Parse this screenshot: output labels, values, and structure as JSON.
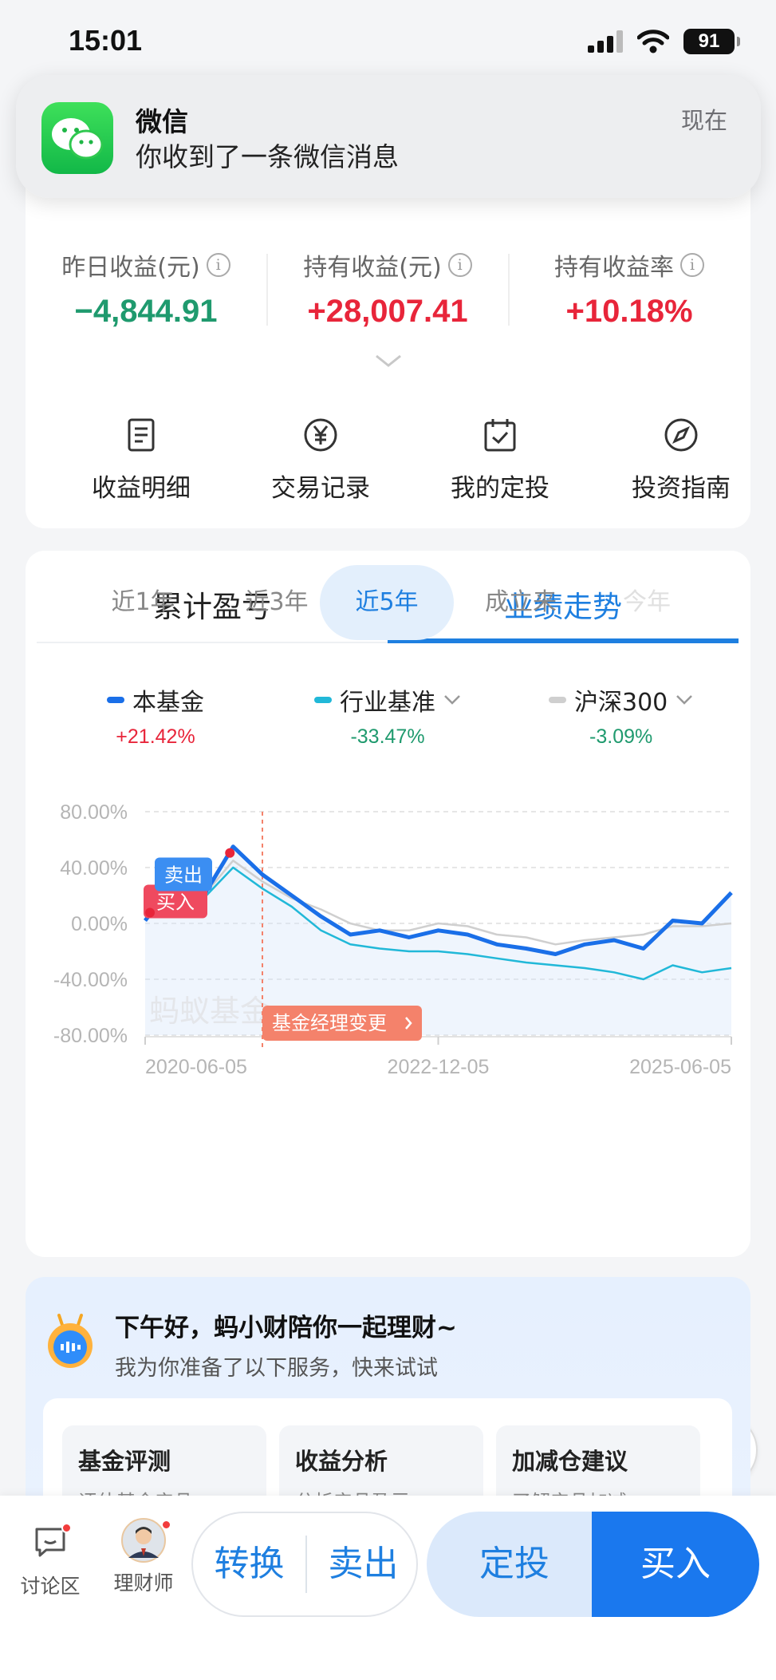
{
  "status_bar": {
    "time": "15:01",
    "battery": "91"
  },
  "notification": {
    "app": "微信",
    "message": "你收到了一条微信消息",
    "time": "现在"
  },
  "profit": {
    "stats": [
      {
        "label": "昨日收益(元)",
        "value": "−4,844.91",
        "color": "#1f9a6e"
      },
      {
        "label": "持有收益(元)",
        "value": "+28,007.41",
        "color": "#e8253a"
      },
      {
        "label": "持有收益率",
        "value": "+10.18%",
        "color": "#e8253a"
      }
    ],
    "actions": [
      {
        "label": "收益明细",
        "icon": "document-icon"
      },
      {
        "label": "交易记录",
        "icon": "yen-circle-icon"
      },
      {
        "label": "我的定投",
        "icon": "calendar-check-icon"
      },
      {
        "label": "投资指南",
        "icon": "compass-icon"
      }
    ]
  },
  "tabs": [
    {
      "label": "累计盈亏",
      "active": false
    },
    {
      "label": "业绩走势",
      "active": true
    }
  ],
  "legend": [
    {
      "name": "本基金",
      "value": "+21.42%",
      "color": "#1a6fe8",
      "value_color": "#e8253a"
    },
    {
      "name": "行业基准",
      "value": "-33.47%",
      "color": "#21b8d8",
      "value_color": "#1f9a6e"
    },
    {
      "name": "沪深300",
      "value": "-3.09%",
      "color": "#cfcfcf",
      "value_color": "#1f9a6e"
    }
  ],
  "chart_data": {
    "type": "line",
    "y_ticks": [
      "80.00%",
      "40.00%",
      "0.00%",
      "-40.00%",
      "-80.00%"
    ],
    "ylim": [
      -80,
      80
    ],
    "x_ticks": [
      "2020-06-05",
      "2022-12-05",
      "2025-06-05"
    ],
    "x": [
      "2020-06-05",
      "2020-09-05",
      "2020-12-05",
      "2021-03-05",
      "2021-06-05",
      "2021-09-05",
      "2021-12-05",
      "2022-03-05",
      "2022-06-05",
      "2022-09-05",
      "2022-12-05",
      "2023-03-05",
      "2023-06-05",
      "2023-09-05",
      "2023-12-05",
      "2024-03-05",
      "2024-06-05",
      "2024-09-05",
      "2024-12-05",
      "2025-03-05",
      "2025-06-05"
    ],
    "series": [
      {
        "name": "本基金",
        "color": "#1a6fe8",
        "values": [
          2,
          30,
          20,
          55,
          35,
          20,
          5,
          -8,
          -5,
          -10,
          -5,
          -8,
          -15,
          -18,
          -22,
          -15,
          -12,
          -18,
          2,
          0,
          22
        ]
      },
      {
        "name": "行业基准",
        "color": "#21b8d8",
        "values": [
          2,
          28,
          18,
          40,
          25,
          12,
          -5,
          -15,
          -18,
          -20,
          -20,
          -22,
          -25,
          -28,
          -30,
          -32,
          -35,
          -40,
          -30,
          -35,
          -32
        ]
      },
      {
        "name": "沪深300",
        "color": "#cfcfcf",
        "values": [
          2,
          25,
          20,
          45,
          30,
          18,
          10,
          0,
          -5,
          -5,
          0,
          -2,
          -8,
          -10,
          -15,
          -12,
          -10,
          -8,
          -2,
          -2,
          0
        ]
      }
    ],
    "markers": [
      {
        "label": "卖出",
        "color": "#3b8ef2"
      },
      {
        "label": "买入",
        "color": "#ef4a5f"
      }
    ],
    "manager_change": {
      "label": "基金经理变更",
      "x": "2021-06-05",
      "color": "#f4826b"
    },
    "watermark": "蚂蚁基金",
    "grid": true
  },
  "ranges": [
    {
      "label": "近1年",
      "active": false
    },
    {
      "label": "近3年",
      "active": false
    },
    {
      "label": "近5年",
      "active": true
    },
    {
      "label": "成立来",
      "active": false
    },
    {
      "label": "今年",
      "active": false
    }
  ],
  "assistant": {
    "title": "下午好，蚂小财陪你一起理财~",
    "subtitle": "我为你准备了以下服务，快来试试",
    "tiles": [
      {
        "title": "基金评测",
        "desc": "评估基金产品"
      },
      {
        "title": "收益分析",
        "desc": "分析产品盈亏"
      },
      {
        "title": "加减仓建议",
        "desc": "了解产品加减"
      }
    ]
  },
  "bottom_bar": {
    "discuss": "讨论区",
    "advisor": "理财师",
    "convert": "转换",
    "sell": "卖出",
    "auto_invest": "定投",
    "buy": "买入"
  }
}
